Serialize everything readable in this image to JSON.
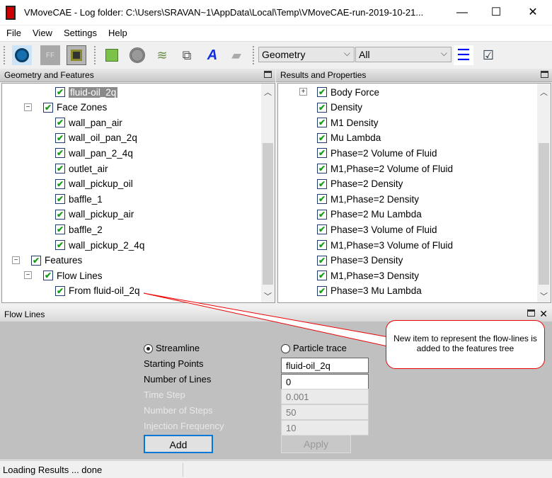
{
  "window": {
    "title": "VMoveCAE - Log folder: C:\\Users\\SRAVAN~1\\AppData\\Local\\Temp\\VMoveCAE-run-2019-10-21...",
    "minimize": "—",
    "maximize": "☐",
    "close": "✕"
  },
  "menu": [
    "File",
    "View",
    "Settings",
    "Help"
  ],
  "toolbar": {
    "icons": [
      "open-icon",
      "ff-icon",
      "save-icon",
      "geometry-cube-icon",
      "disc-icon",
      "flow-icon",
      "layers-add-icon",
      "text-a-icon",
      "stack-icon"
    ],
    "text_icon": "A",
    "combo1": "Geometry",
    "combo2": "All",
    "chev": "⌵"
  },
  "left_panel": {
    "title": "Geometry and Features",
    "items": [
      {
        "label": "fluid-oil_2q",
        "level": 3,
        "selected": true
      },
      {
        "label": "Face Zones",
        "level": 2,
        "expander": "−"
      },
      {
        "label": "wall_pan_air",
        "level": 3
      },
      {
        "label": "wall_oil_pan_2q",
        "level": 3
      },
      {
        "label": "wall_pan_2_4q",
        "level": 3
      },
      {
        "label": "outlet_air",
        "level": 3
      },
      {
        "label": "wall_pickup_oil",
        "level": 3
      },
      {
        "label": "baffle_1",
        "level": 3
      },
      {
        "label": "wall_pickup_air",
        "level": 3
      },
      {
        "label": "baffle_2",
        "level": 3
      },
      {
        "label": "wall_pickup_2_4q",
        "level": 3
      },
      {
        "label": "Features",
        "level": 1,
        "expander": "−"
      },
      {
        "label": "Flow Lines",
        "level": 2,
        "expander": "−"
      },
      {
        "label": "From fluid-oil_2q",
        "level": 3
      }
    ]
  },
  "right_panel": {
    "title": "Results and Properties",
    "items": [
      {
        "label": "Body Force",
        "expander": "+"
      },
      {
        "label": "Density"
      },
      {
        "label": "M1 Density"
      },
      {
        "label": "Mu Lambda"
      },
      {
        "label": "Phase=2 Volume of Fluid"
      },
      {
        "label": "M1,Phase=2 Volume of Fluid"
      },
      {
        "label": "Phase=2 Density"
      },
      {
        "label": "M1,Phase=2 Density"
      },
      {
        "label": "Phase=2 Mu Lambda"
      },
      {
        "label": "Phase=3 Volume of Fluid"
      },
      {
        "label": "M1,Phase=3 Volume of Fluid"
      },
      {
        "label": "Phase=3 Density"
      },
      {
        "label": "M1,Phase=3 Density"
      },
      {
        "label": "Phase=3 Mu Lambda"
      }
    ]
  },
  "flow_lines": {
    "title": "Flow Lines",
    "close": "✕",
    "streamline": "Streamline",
    "particle_trace": "Particle trace",
    "selected_mode": "Streamline",
    "starting_points_label": "Starting Points",
    "starting_points": "fluid-oil_2q",
    "num_lines_label": "Number of Lines",
    "num_lines": "0",
    "time_step_label": "Time Step",
    "time_step": "0.001",
    "num_steps_label": "Number of Steps",
    "num_steps": "50",
    "injection_label": "Injection Frequency",
    "injection": "10",
    "add": "Add",
    "apply": "Apply"
  },
  "callout": "New item to represent the flow-lines is added to the features tree",
  "status": "Loading Results ... done",
  "colors": {
    "check": "#1a9a1a",
    "callout_border": "#e00000",
    "panel_bg": "#c0c0c0"
  }
}
